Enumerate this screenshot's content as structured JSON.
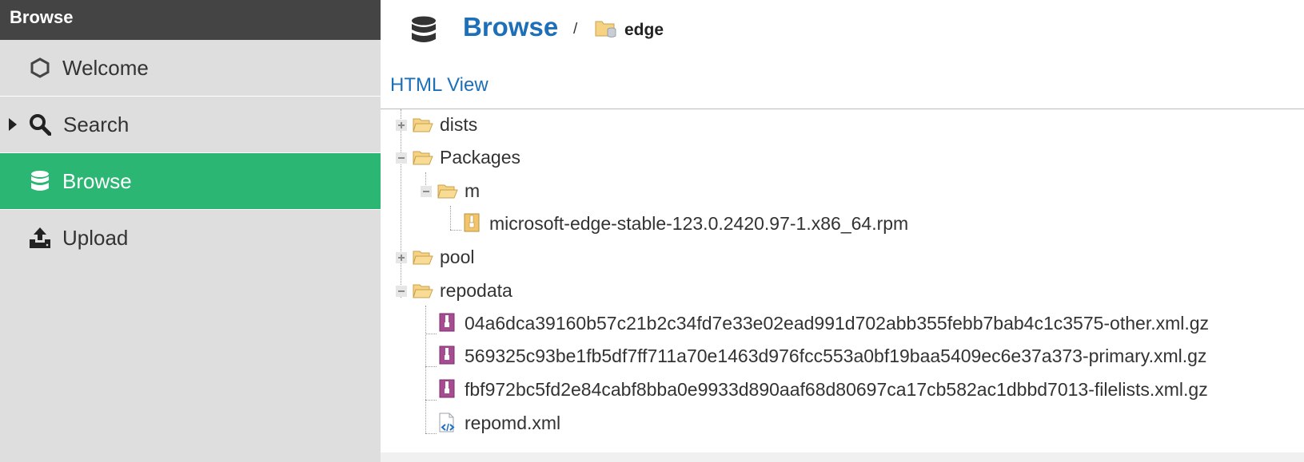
{
  "sidebar": {
    "title": "Browse",
    "items": [
      {
        "label": "Welcome",
        "icon": "hexagon-icon"
      },
      {
        "label": "Search",
        "icon": "search-icon",
        "expandable": true
      },
      {
        "label": "Browse",
        "icon": "database-icon",
        "active": true
      },
      {
        "label": "Upload",
        "icon": "upload-icon"
      }
    ]
  },
  "breadcrumb": {
    "root": "Browse",
    "separator": "/",
    "current": "edge"
  },
  "html_view_label": "HTML View",
  "tree": {
    "nodes": [
      {
        "label": "dists",
        "type": "folder",
        "state": "collapsed"
      },
      {
        "label": "Packages",
        "type": "folder",
        "state": "expanded"
      },
      {
        "label": "m",
        "type": "folder",
        "state": "expanded"
      },
      {
        "label": "microsoft-edge-stable-123.0.2420.97-1.x86_64.rpm",
        "type": "archive"
      },
      {
        "label": "pool",
        "type": "folder",
        "state": "collapsed"
      },
      {
        "label": "repodata",
        "type": "folder",
        "state": "expanded"
      },
      {
        "label": "04a6dca39160b57c21b2c34fd7e33e02ead991d702abb355febb7bab4c1c3575-other.xml.gz",
        "type": "gz"
      },
      {
        "label": "569325c93be1fb5df7ff711a70e1463d976fcc553a0bf19baa5409ec6e37a373-primary.xml.gz",
        "type": "gz"
      },
      {
        "label": "fbf972bc5fd2e84cabf8bba0e9933d890aaf68d80697ca17cb582ac1dbbd7013-filelists.xml.gz",
        "type": "gz"
      },
      {
        "label": "repomd.xml",
        "type": "xml"
      }
    ]
  },
  "colors": {
    "accent_green": "#2bb673",
    "link_blue": "#1d6fb8",
    "sidebar_header": "#444444",
    "sidebar_bg": "#dedede",
    "folder_yellow": "#f0c36d",
    "gz_purple": "#a64d92"
  }
}
